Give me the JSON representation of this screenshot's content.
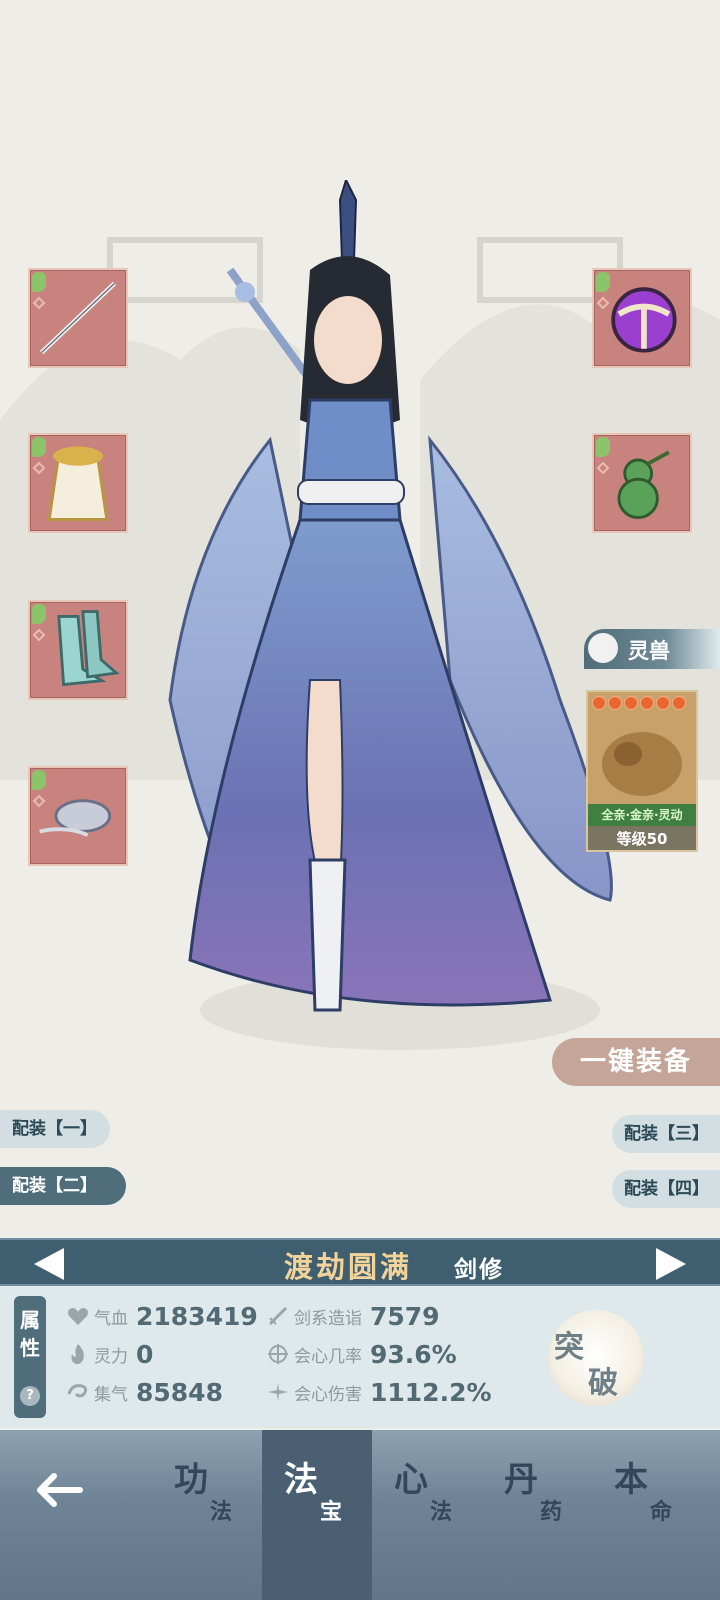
{
  "equipment": {
    "left_slots": [
      "sword-icon",
      "robe-icon",
      "boots-icon",
      "ornament-icon"
    ],
    "right_slots": [
      "purple-orb-icon",
      "gourd-icon"
    ]
  },
  "pet": {
    "tab_label": "灵兽",
    "traits": "全亲·金亲·灵动",
    "level": "等级50",
    "stars": 6
  },
  "equip_all_label": "一键装备",
  "loadouts": {
    "one": "配装【一】",
    "two": "配装【二】",
    "three": "配装【三】",
    "four": "配装【四】"
  },
  "realm": {
    "title": "渡劫圆满",
    "class": "剑修"
  },
  "attributes": {
    "tab_label_1": "属",
    "tab_label_2": "性",
    "help": "?",
    "hp": {
      "name": "气血",
      "value": "2183419"
    },
    "spirit_power": {
      "name": "灵力",
      "value": "0"
    },
    "gather_qi": {
      "name": "集气",
      "value": "85848"
    },
    "sword_mastery": {
      "name": "剑系造诣",
      "value": "7579"
    },
    "crit_rate": {
      "name": "会心几率",
      "value": "93.6%"
    },
    "crit_damage": {
      "name": "会心伤害",
      "value": "1112.2%"
    }
  },
  "breakthrough": {
    "char1": "突",
    "char2": "破"
  },
  "nav": {
    "tabs": [
      {
        "big": "功",
        "small": "法"
      },
      {
        "big": "法",
        "small": "宝"
      },
      {
        "big": "心",
        "small": "法"
      },
      {
        "big": "丹",
        "small": "药"
      },
      {
        "big": "本",
        "small": "命"
      }
    ],
    "active_index": 1
  },
  "colors": {
    "slot_bg": "#c9837f",
    "panel_accent": "#4f6d7b",
    "realm_title": "#f2d39a"
  }
}
